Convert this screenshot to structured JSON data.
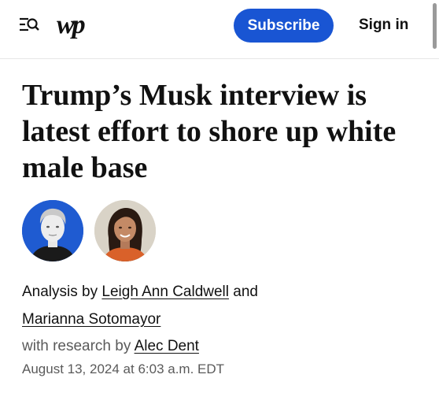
{
  "header": {
    "logo_text": "wp",
    "subscribe_label": "Subscribe",
    "signin_label": "Sign in",
    "accent_color": "#1955d3"
  },
  "article": {
    "headline": "Trump’s Musk interview is latest effort to shore up white male base",
    "byline": {
      "prefix": "Analysis by",
      "author_1": "Leigh Ann Caldwell",
      "conjunction": "and",
      "author_2": "Marianna Sotomayor",
      "research_prefix": "with research by",
      "researcher": "Alec Dent"
    },
    "dateline": "August 13, 2024 at 6:03 a.m. EDT"
  },
  "icons": {
    "menu": "menu-search-icon",
    "logo": "washington-post-logo"
  }
}
